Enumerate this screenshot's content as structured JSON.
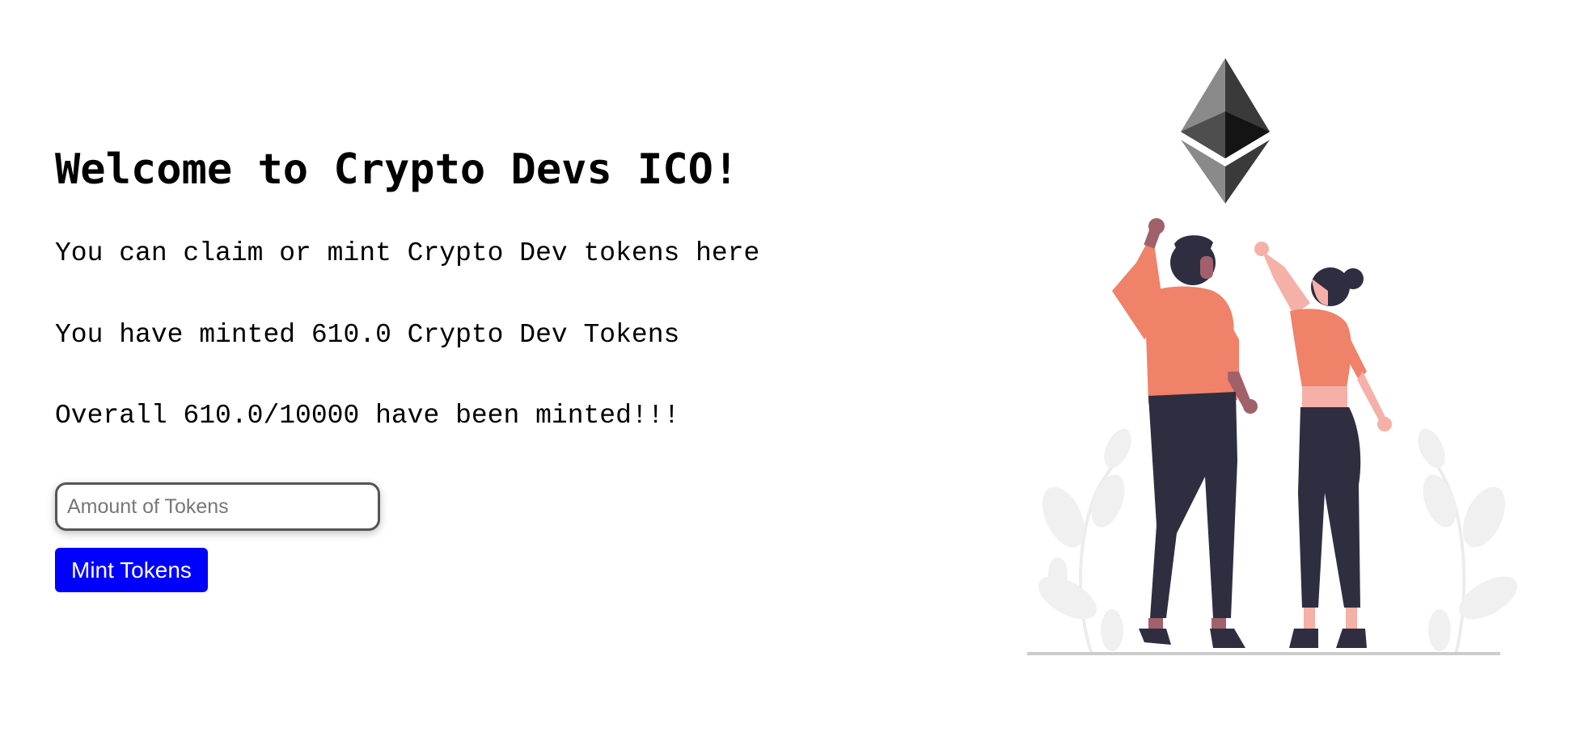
{
  "main": {
    "title": "Welcome to Crypto Devs ICO!",
    "description": "You can claim or mint Crypto Dev tokens here",
    "minted_line": "You have minted 610.0 Crypto Dev Tokens",
    "overall_line": "Overall 610.0/10000 have been minted!!!",
    "amount_input": {
      "placeholder": "Amount of Tokens",
      "value": ""
    },
    "mint_button_label": "Mint Tokens"
  },
  "illustration": {
    "name": "ethereum-celebration-illustration",
    "colors": {
      "shirt": "#ef8269",
      "pants": "#2f2e41",
      "skin_dark": "#a0616a",
      "skin_light": "#f5b0a8",
      "leaf": "#f0f0f0",
      "ground": "#cccccc"
    }
  },
  "colors": {
    "button_bg": "#0000ff",
    "button_text": "#ffffff",
    "text": "#000000"
  }
}
